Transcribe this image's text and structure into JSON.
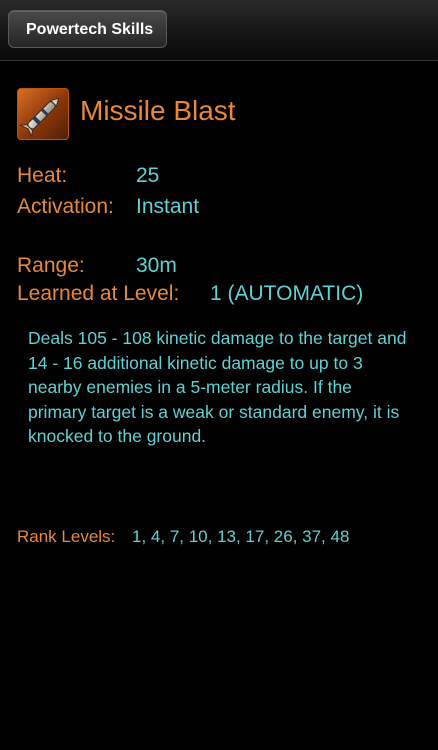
{
  "nav": {
    "back_label": "Powertech Skills"
  },
  "skill": {
    "icon": "missile-icon",
    "name": "Missile Blast",
    "heat_label": "Heat:",
    "heat_value": "25",
    "activation_label": "Activation:",
    "activation_value": "Instant",
    "range_label": "Range:",
    "range_value": "30m",
    "learned_label": "Learned at Level:",
    "learned_value": "1 (AUTOMATIC)",
    "description": "Deals 105 - 108 kinetic damage to the target and 14 - 16 additional kinetic damage to up to 3 nearby enemies in a 5-meter radius. If the primary target is a weak or standard enemy, it is knocked to the ground.",
    "rank_label": "Rank Levels:",
    "rank_values": "1, 4, 7, 10, 13, 17, 26, 37, 48"
  },
  "colors": {
    "label": "#e8883a",
    "value": "#5fd2d6",
    "background": "#000000"
  }
}
